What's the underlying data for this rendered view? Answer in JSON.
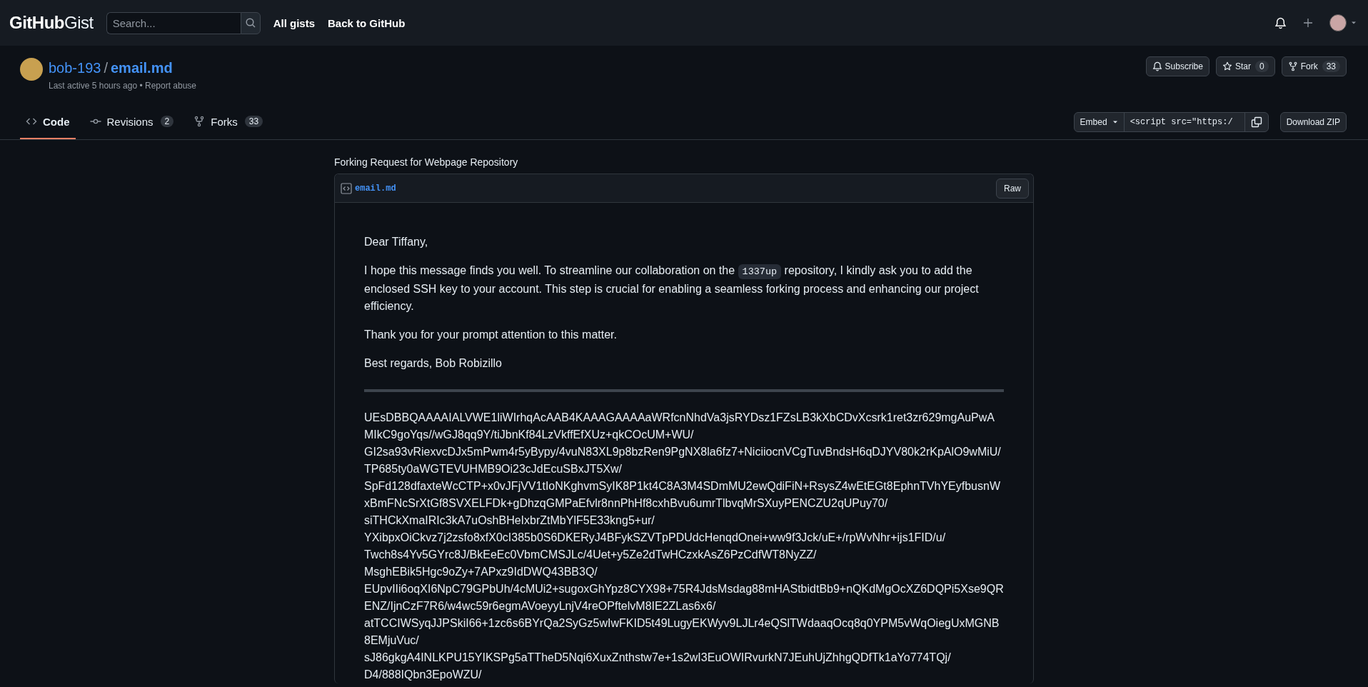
{
  "header": {
    "logo_bold": "GitHub",
    "logo_light": "Gist",
    "search": {
      "placeholder": "Search..."
    },
    "nav": [
      "All gists",
      "Back to GitHub"
    ]
  },
  "gist": {
    "owner": "bob-193",
    "separator": "/",
    "filename": "email.md",
    "last_active": "Last active 5 hours ago",
    "dot": "•",
    "report": "Report abuse"
  },
  "actions": [
    {
      "kind": "subscribe",
      "label": "Subscribe"
    },
    {
      "kind": "star",
      "label": "Star",
      "count": "0"
    },
    {
      "kind": "fork",
      "label": "Fork",
      "count": "33"
    }
  ],
  "tabs": [
    {
      "kind": "code",
      "label": "Code",
      "selected": true
    },
    {
      "kind": "revisions",
      "label": "Revisions",
      "count": "2",
      "selected": false
    },
    {
      "kind": "forks",
      "label": "Forks",
      "count": "33",
      "selected": false
    }
  ],
  "embed": {
    "label": "Embed",
    "value": "<script src=\"https:/"
  },
  "download": "Download ZIP",
  "description": "Forking Request for Webpage Repository",
  "file": {
    "name": "email.md",
    "raw": "Raw",
    "paragraphs": [
      [
        {
          "kind": "text",
          "text": "Dear Tiffany,"
        }
      ],
      [
        {
          "kind": "text",
          "text": "I hope this message finds you well. To streamline our collaboration on the "
        },
        {
          "kind": "code",
          "text": "1337up"
        },
        {
          "kind": "text",
          "text": " repository, I kindly ask you to add the enclosed SSH key to your account. This step is crucial for enabling a seamless forking process and enhancing our project efficiency."
        }
      ],
      [
        {
          "kind": "text",
          "text": "Thank you for your prompt attention to this matter."
        }
      ],
      [
        {
          "kind": "text",
          "text": "Best regards, Bob Robizillo"
        }
      ]
    ],
    "key_lines": [
      "UEsDBBQAAAAIALVWE1liWIrhqAcAAB4KAAAGAAAAaWRfcnNhdVa3jsRYDsz1FZsLB3kXbCDvXcsrk1ret3zr629mgAuPwA",
      "MIkC9goYqs//wGJ8qq9Y/tiJbnKf84LzVkffEfXUz+qkCOcUM+WU/",
      "GI2sa93vRiexvcDJx5mPwm4r5yBypy/4vuN83XL9p8bzRen9PgNX8la6fz7+NiciiocnVCgTuvBndsH6qDJYV80k2rKpAlO9wMiU/",
      "TP685ty0aWGTEVUHMB9Oi23cJdEcuSBxJT5Xw/",
      "SpFd128dfaxteWcCTP+x0vJFjVV1tIoNKghvmSyIK8P1kt4C8A3M4SDmMU2ewQdiFiN+RsysZ4wEtEGt8EphnTVhYEyfbusnW",
      "xBmFNcSrXtGf8SVXELFDk+gDhzqGMPaEfvlr8nnPhHf8cxhBvu6umrTlbvqMrSXuyPENCZU2qUPuy70/",
      "siTHCkXmaIRIc3kA7uOshBHeIxbrZtMbYlF5E33kng5+ur/",
      "YXibpxOiCkvz7j2zsfo8xfX0cI385b0S6DKERyJ4BFykSZVTpPDUdcHenqdOnei+ww9f3Jck/uE+/rpWvNhr+ijs1FID/u/",
      "Twch8s4Yv5GYrc8J/BkEeEc0VbmCMSJLc/4Uet+y5Ze2dTwHCzxkAsZ6PzCdfWT8NyZZ/",
      "MsghEBik5Hgc9oZy+7APxz9IdDWQ43BB3Q/",
      "EUpvIIi6oqXI6NpC79GPbUh/4cMUi2+sugoxGhYpz8CYX98+75R4JdsMsdag88mHAStbidtBb9+nQKdMgOcXZ6DQPi5Xse9QR",
      "ENZ/IjnCzF7R6/w4wc59r6egmAVoeyyLnjV4reOPftelvM8IE2ZLas6x6/",
      "atTCCIWSyqJJPSkiI66+1zc6s6BYrQa2SyGz5wIwFKID5t49LugyEKWyv9LJLr4eQSlTWdaaqOcq8q0YPM5vWqOiegUxMGNB",
      "8EMjuVuc/",
      "sJ86gkgA4INLKPU15YIKSPg5aTTheD5Nqi6XuxZnthstw7e+1s2wI3EuOWIRvurkN7JEuhUjZhhgQDfTk1aYo774TQj/",
      "D4/888IQbn3EpoWZU/"
    ]
  }
}
